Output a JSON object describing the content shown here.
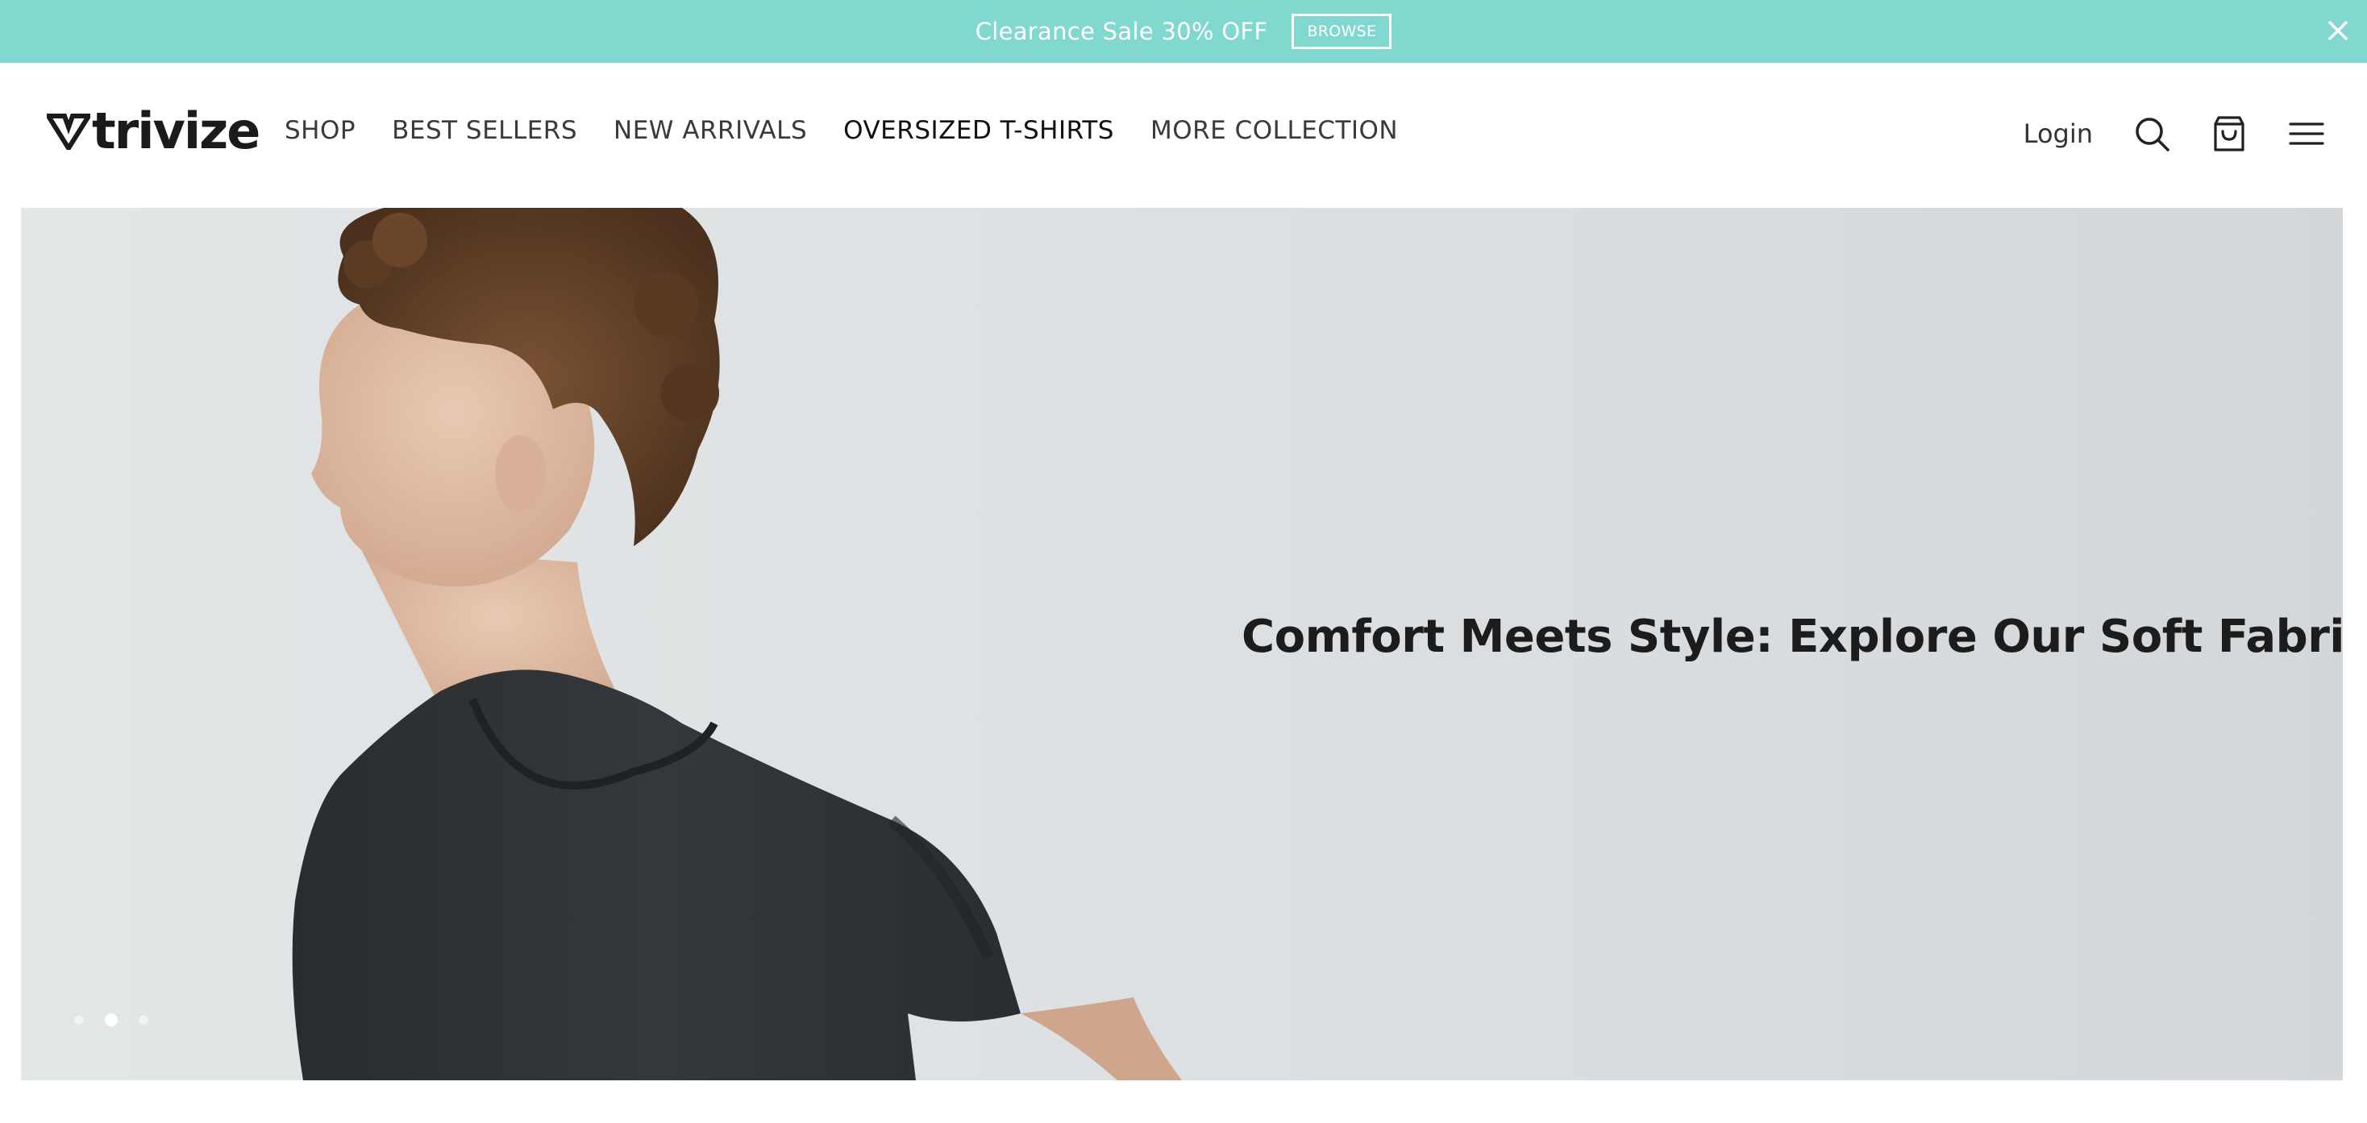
{
  "announcement": {
    "text": "Clearance Sale 30% OFF",
    "button_label": "BROWSE",
    "close_icon": "close-icon",
    "background": "#80d8cf"
  },
  "header": {
    "logo_text": "trivize",
    "nav": [
      {
        "label": "SHOP"
      },
      {
        "label": "BEST SELLERS"
      },
      {
        "label": "NEW ARRIVALS"
      },
      {
        "label": "OVERSIZED T-SHIRTS"
      },
      {
        "label": "MORE COLLECTION"
      }
    ],
    "login_label": "Login",
    "icons": [
      "search-icon",
      "shopping-bag-icon",
      "hamburger-menu-icon"
    ]
  },
  "hero": {
    "heading": "Comfort Meets Style: Explore Our Soft Fabrics",
    "slides_total": 3,
    "active_slide": 2
  }
}
